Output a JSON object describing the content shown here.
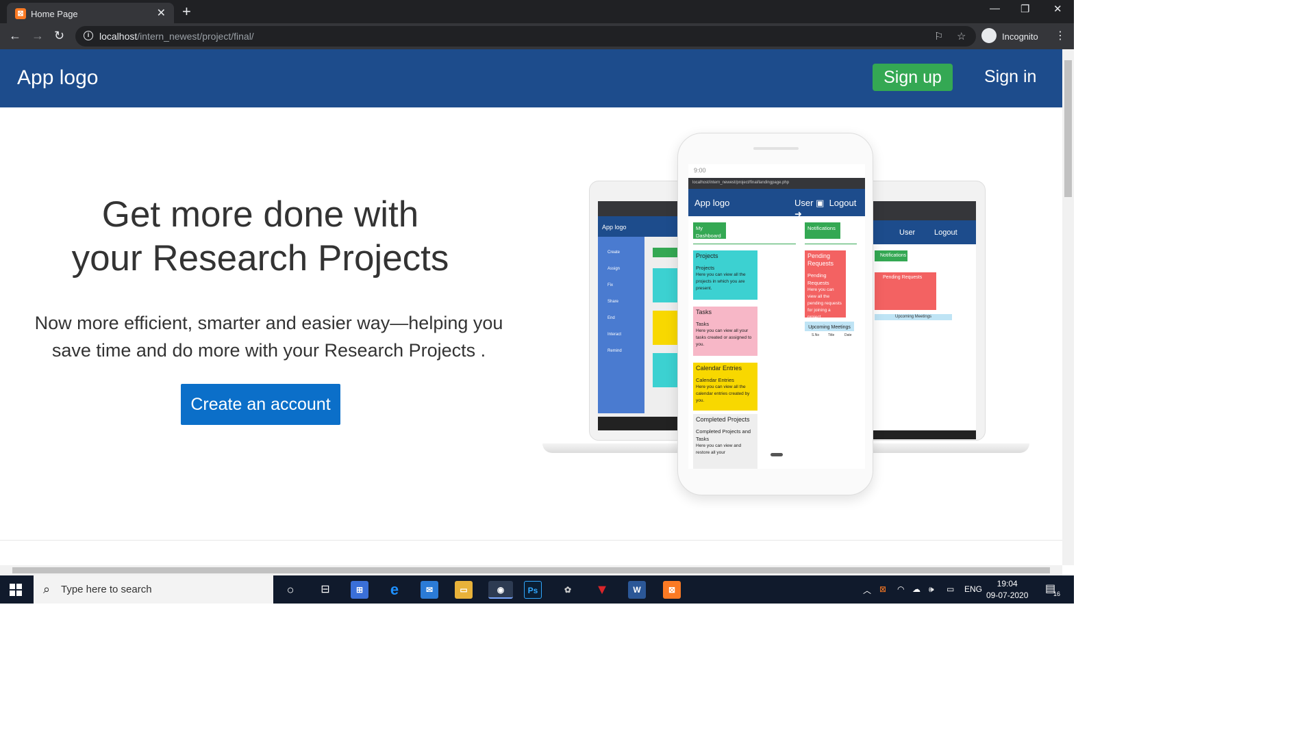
{
  "browser": {
    "tab_title": "Home Page",
    "url_host": "localhost",
    "url_path": "/intern_newest/project/final/",
    "profile_label": "Incognito"
  },
  "header": {
    "logo": "App logo",
    "signup": "Sign up",
    "signin": "Sign in"
  },
  "hero": {
    "title_line1": "Get more done with",
    "title_line2": "your Research Projects",
    "subtitle_line1": "Now more efficient, smarter and easier way—helping you",
    "subtitle_line2": "save time and do more with your Research Projects .",
    "cta": "Create an account"
  },
  "mockup": {
    "phone_time": "9:00",
    "phone_url": "localhost/intern_newest/project/final/landingpage.php",
    "app_logo": "App logo",
    "user": "User",
    "logout": "Logout",
    "dashboard": "My Dashboard",
    "notifications": "Notifications",
    "cards": [
      {
        "head": "Projects",
        "title": "Projects",
        "desc": "Here you can view all the projects in which you are present.",
        "color": "#3cd1d1"
      },
      {
        "head": "Tasks",
        "title": "Tasks",
        "desc": "Here you can view all your tasks created or assigned to you.",
        "color": "#f7b7c7"
      },
      {
        "head": "Calendar Entries",
        "title": "Calendar Entries",
        "desc": "Here you can view all the calendar entries created by you.",
        "color": "#f8d800"
      },
      {
        "head": "Completed Projects",
        "title": "Completed Projects and Tasks",
        "desc": "Here you can view and restore all your",
        "color": "#eeeeee"
      }
    ],
    "pending_head": "Pending Requests",
    "pending_title": "Pending Requests",
    "pending_desc": "Here you can view all the pending requests for joining a project.",
    "meetings_head": "Upcoming Meetings",
    "meeting_cols": [
      "S.No",
      "Title",
      "Date"
    ],
    "sidebar": [
      "Create",
      "Assign",
      "Fix",
      "Share",
      "End",
      "Interact",
      "Remind"
    ]
  },
  "taskbar": {
    "search_placeholder": "Type here to search",
    "lang": "ENG",
    "time": "19:04",
    "date": "09-07-2020",
    "notif_count": "16"
  }
}
